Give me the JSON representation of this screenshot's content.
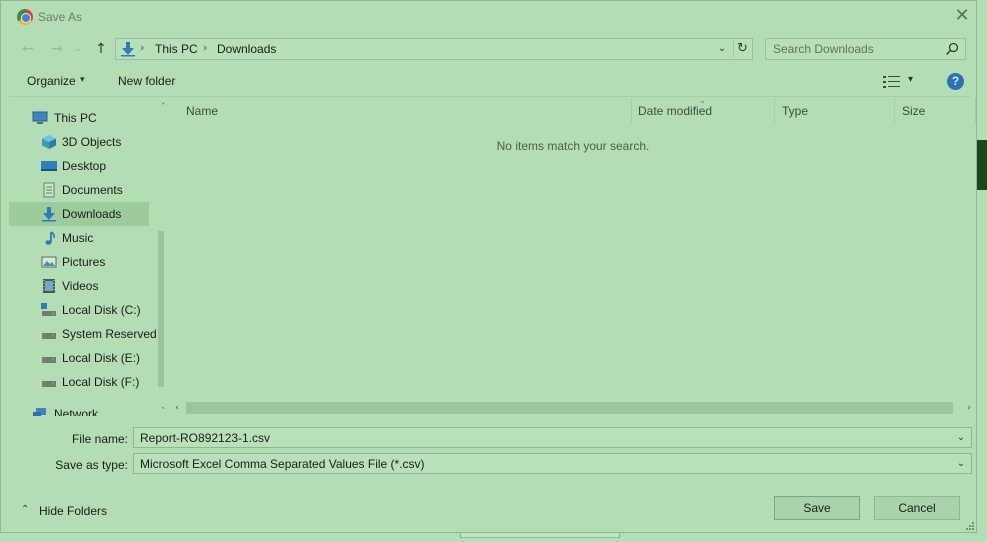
{
  "dialog": {
    "title": "Save As",
    "close_glyph": "✕",
    "icons": {
      "app": "chrome-icon",
      "close": "close-icon"
    }
  },
  "addressbar": {
    "nav": {
      "back": "←",
      "forward": "→",
      "recent": "⌄",
      "up": "↑"
    },
    "crumbs": [
      "This PC",
      "Downloads"
    ],
    "separator": "›",
    "dropdown_glyph": "⌄",
    "refresh_glyph": "↻",
    "location_icon": "downloads-icon"
  },
  "search": {
    "placeholder": "Search Downloads",
    "icon": "search-icon"
  },
  "toolbar": {
    "organize": "Organize",
    "organize_caret": "▾",
    "new_folder": "New folder",
    "help": "?",
    "view_caret": "▾"
  },
  "navpane": {
    "items": [
      {
        "label": "This PC",
        "icon": "computer-icon"
      },
      {
        "label": "3D Objects",
        "icon": "cube-icon"
      },
      {
        "label": "Desktop",
        "icon": "desktop-icon"
      },
      {
        "label": "Documents",
        "icon": "document-icon"
      },
      {
        "label": "Downloads",
        "icon": "download-icon",
        "selected": true
      },
      {
        "label": "Music",
        "icon": "music-icon"
      },
      {
        "label": "Pictures",
        "icon": "picture-icon"
      },
      {
        "label": "Videos",
        "icon": "video-icon"
      },
      {
        "label": "Local Disk (C:)",
        "icon": "drive-icon"
      },
      {
        "label": "System Reserved",
        "icon": "drive-icon"
      },
      {
        "label": "Local Disk (E:)",
        "icon": "drive-icon"
      },
      {
        "label": "Local Disk (F:)",
        "icon": "drive-icon"
      },
      {
        "label": "Network",
        "icon": "network-icon"
      }
    ],
    "scroll_up": "⌃",
    "scroll_down": "⌄"
  },
  "filelist": {
    "columns": [
      "Name",
      "Date modified",
      "Type",
      "Size"
    ],
    "sort_caret": "⌄",
    "empty_message": "No items match your search.",
    "scroll_left": "‹",
    "scroll_right": "›"
  },
  "form": {
    "file_name_label": "File name:",
    "file_name_value": "Report-RO892123-1.csv",
    "save_type_label": "Save as type:",
    "save_type_value": "Microsoft Excel Comma Separated Values File (*.csv)",
    "dropdown_glyph": "⌄"
  },
  "footer": {
    "hide_folders": "Hide Folders",
    "hide_chevron": "⌃",
    "save": "Save",
    "cancel": "Cancel"
  },
  "colors": {
    "dialog_bg": "#b3ddb3",
    "selection": "#9ccb9c",
    "help_blue": "#2a6fb8",
    "background_app": "#1f4a1f"
  }
}
